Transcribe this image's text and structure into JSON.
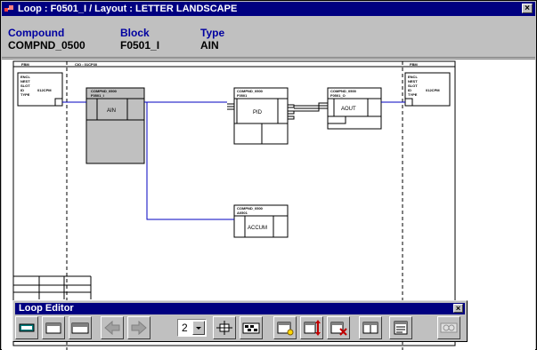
{
  "window": {
    "title": "Loop : F0501_I / Layout : LETTER LANDSCAPE",
    "close_label": "×"
  },
  "info": {
    "compound_label": "Compound",
    "compound_value": "COMPND_0500",
    "block_label": "Block",
    "block_value": "F0501_I",
    "type_label": "Type",
    "type_value": "AIN"
  },
  "diagram": {
    "column_headers": [
      "FBM",
      "CIO  : 01CP30",
      "FBM"
    ],
    "left_fbm_lines": [
      "ENCL",
      "NEST",
      "SLOT",
      "ID",
      "TYPE"
    ],
    "left_fbm_id": "012CPM",
    "right_fbm_lines": [
      "ENCL",
      "NEST",
      "SLOT",
      "ID",
      "TYPE"
    ],
    "right_fbm_id": "012CPM",
    "blocks": [
      {
        "header1": "COMPND_0500",
        "header2": "F0501_I",
        "label": "AIN"
      },
      {
        "header1": "COMPND_0500",
        "header2": "F0501",
        "label": "PID"
      },
      {
        "header1": "COMPND_0500",
        "header2": "F0501_O",
        "label": "AOUT"
      },
      {
        "header1": "COMPND_0500",
        "header2": "A0501",
        "label": "ACCUM"
      }
    ]
  },
  "toolbar": {
    "title": "Loop Editor",
    "close_label": "×",
    "page_select_value": "2",
    "icons": [
      "display-mode-icon",
      "layout-normal-icon",
      "layout-wide-icon",
      "back-arrow-icon",
      "forward-arrow-icon",
      "fit-center-icon",
      "overview-icon",
      "add-block-icon",
      "move-block-icon",
      "delete-block-icon",
      "split-view-icon",
      "properties-icon",
      "print-preview-icon"
    ]
  },
  "colors": {
    "titlebar": "#000080",
    "label_blue": "#0000a0",
    "wire_blue": "#0000c0",
    "selected_block": "#c0c0c0"
  }
}
